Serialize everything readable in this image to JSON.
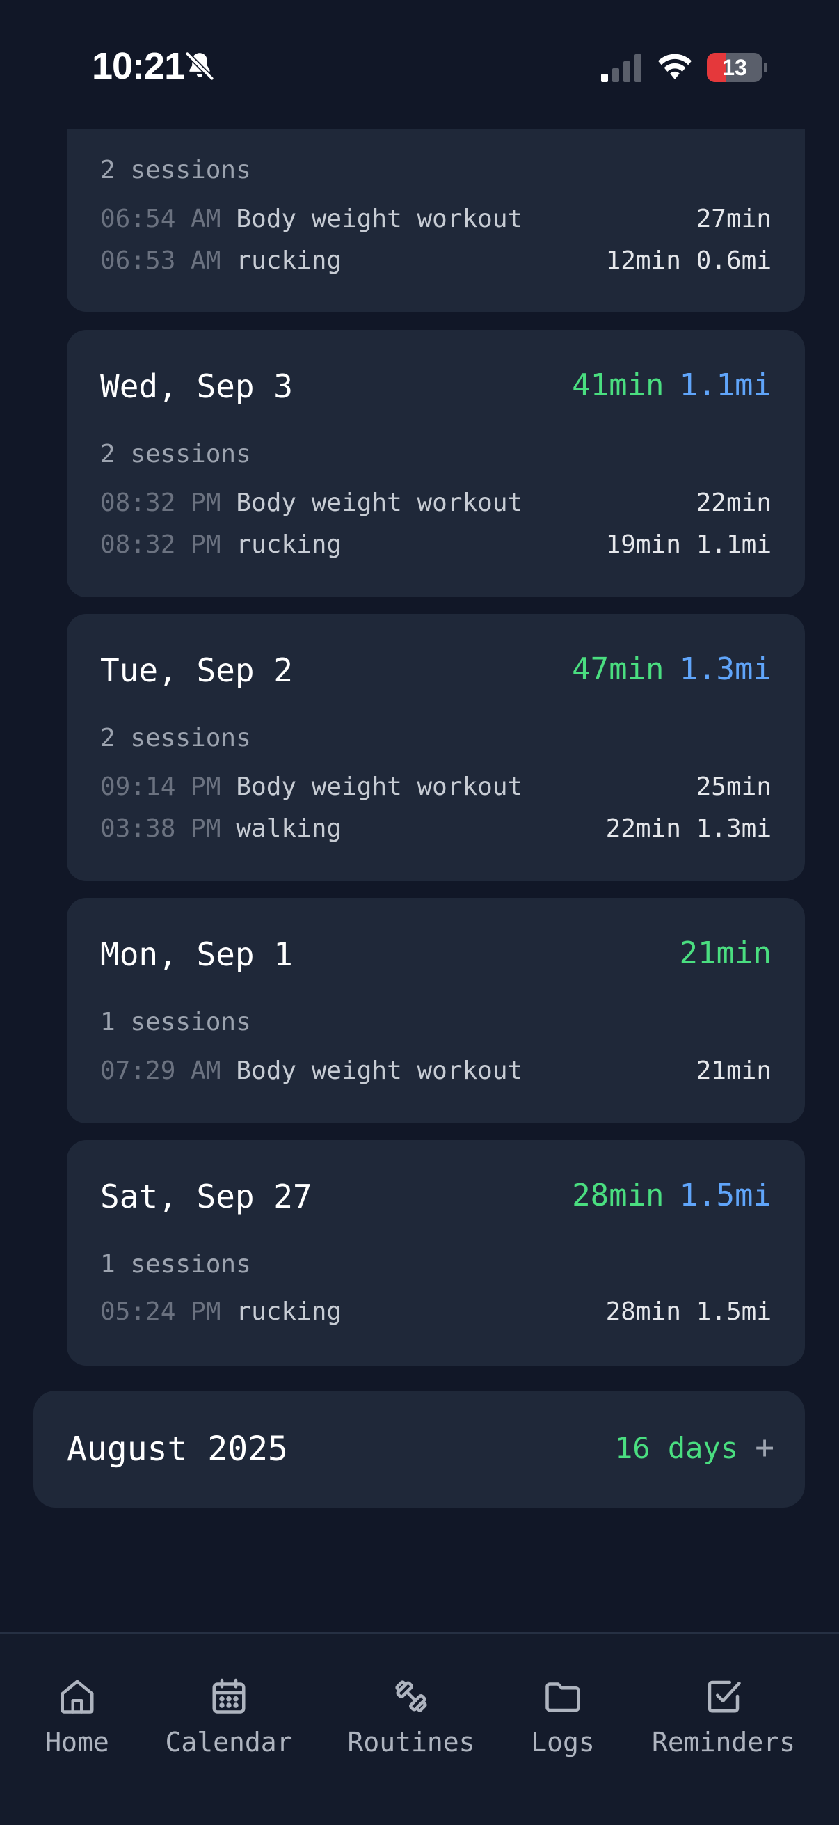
{
  "status_bar": {
    "time": "10:21",
    "battery_level": "13",
    "icons": [
      "bell-slash-icon",
      "cellular-signal-icon",
      "wifi-icon",
      "battery-charging-icon"
    ]
  },
  "days": [
    {
      "title": "",
      "total_min": "",
      "total_mi": "",
      "sessions_label": "2 sessions",
      "sessions": [
        {
          "time": "06:54 AM",
          "name": "Body weight workout",
          "stats": "27min"
        },
        {
          "time": "06:53 AM",
          "name": "rucking",
          "stats": "12min 0.6mi"
        }
      ]
    },
    {
      "title": "Wed, Sep 3",
      "total_min": "41min",
      "total_mi": "1.1mi",
      "sessions_label": "2 sessions",
      "sessions": [
        {
          "time": "08:32 PM",
          "name": "Body weight workout",
          "stats": "22min"
        },
        {
          "time": "08:32 PM",
          "name": "rucking",
          "stats": "19min 1.1mi"
        }
      ]
    },
    {
      "title": "Tue, Sep 2",
      "total_min": "47min",
      "total_mi": "1.3mi",
      "sessions_label": "2 sessions",
      "sessions": [
        {
          "time": "09:14 PM",
          "name": "Body weight workout",
          "stats": "25min"
        },
        {
          "time": "03:38 PM",
          "name": "walking",
          "stats": "22min 1.3mi"
        }
      ]
    },
    {
      "title": "Mon, Sep 1",
      "total_min": "21min",
      "total_mi": "",
      "sessions_label": "1 sessions",
      "sessions": [
        {
          "time": "07:29 AM",
          "name": "Body weight workout",
          "stats": "21min"
        }
      ]
    },
    {
      "title": "Sat, Sep 27",
      "total_min": "28min",
      "total_mi": "1.5mi",
      "sessions_label": "1 sessions",
      "sessions": [
        {
          "time": "05:24 PM",
          "name": "rucking",
          "stats": "28min 1.5mi"
        }
      ]
    }
  ],
  "month": {
    "title": "August 2025",
    "days": "16 days",
    "expand": "+"
  },
  "nav": [
    {
      "label": "Home",
      "icon": "home-icon"
    },
    {
      "label": "Calendar",
      "icon": "calendar-icon"
    },
    {
      "label": "Routines",
      "icon": "dumbbell-icon"
    },
    {
      "label": "Logs",
      "icon": "folder-icon"
    },
    {
      "label": "Reminders",
      "icon": "checkbox-icon"
    }
  ],
  "colors": {
    "background": "#111727",
    "card": "#1f2839",
    "minutes": "#4ade80",
    "miles": "#60a5fa",
    "battery_low": "#e5383b"
  }
}
